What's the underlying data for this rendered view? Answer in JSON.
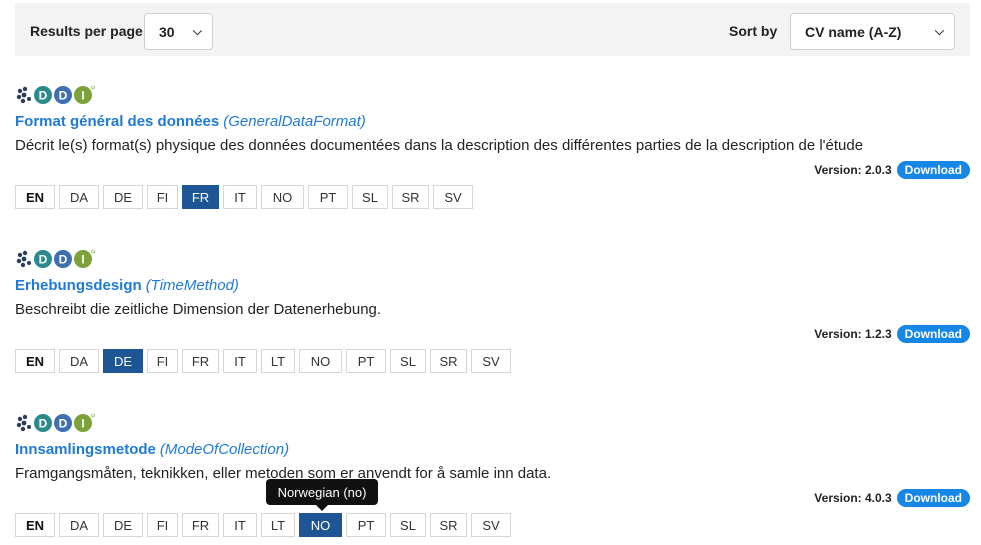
{
  "toolbar": {
    "results_label": "Results per page",
    "results_value": "30",
    "sort_label": "Sort by",
    "sort_value": "CV name (A-Z)"
  },
  "logo_text": "DDI",
  "colors": {
    "link": "#1f7ad6",
    "active_lang": "#1d5595",
    "download_badge": "#1787e6",
    "toolbar_bg": "#f3f3f3"
  },
  "cvs": [
    {
      "title": "Format général des données",
      "id": "(GeneralDataFormat)",
      "description": "Décrit le(s) format(s) physique des données documentées dans la description des différentes parties de la description de l'étude",
      "version": "Version: 2.0.3",
      "download": "Download",
      "languages": [
        "EN",
        "DA",
        "DE",
        "FI",
        "FR",
        "IT",
        "NO",
        "PT",
        "SL",
        "SR",
        "SV"
      ],
      "active": "FR"
    },
    {
      "title": "Erhebungsdesign",
      "id": "(TimeMethod)",
      "description": "Beschreibt die zeitliche Dimension der Datenerhebung.",
      "version": "Version: 1.2.3",
      "download": "Download",
      "languages": [
        "EN",
        "DA",
        "DE",
        "FI",
        "FR",
        "IT",
        "LT",
        "NO",
        "PT",
        "SL",
        "SR",
        "SV"
      ],
      "active": "DE"
    },
    {
      "title": "Innsamlingsmetode",
      "id": "(ModeOfCollection)",
      "description": "Framgangsmåten, teknikken, eller metoden som er anvendt for å samle inn data.",
      "version": "Version: 4.0.3",
      "download": "Download",
      "languages": [
        "EN",
        "DA",
        "DE",
        "FI",
        "FR",
        "IT",
        "LT",
        "NO",
        "PT",
        "SL",
        "SR",
        "SV"
      ],
      "active": "NO"
    }
  ],
  "tooltip": "Norwegian (no)"
}
